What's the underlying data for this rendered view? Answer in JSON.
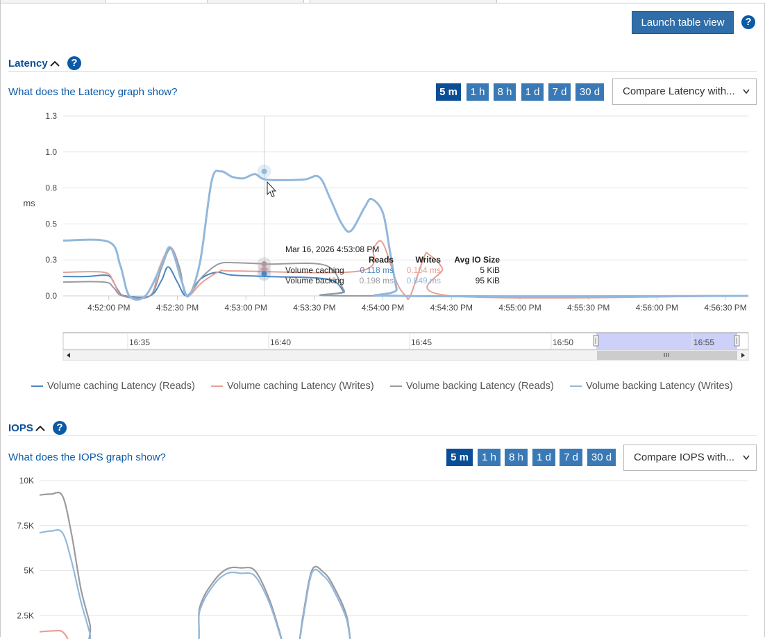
{
  "header": {
    "launch_label": "Launch table view",
    "help_glyph": "?"
  },
  "latency": {
    "title": "Latency",
    "help_glyph": "?",
    "info_link": "What does the Latency graph show?",
    "ranges": [
      "5 m",
      "1 h",
      "8 h",
      "1 d",
      "7 d",
      "30 d"
    ],
    "active_range": "5 m",
    "compare_label": "Compare Latency with...",
    "navigator_ticks": [
      "16:35",
      "16:40",
      "16:45",
      "16:50",
      "16:55"
    ],
    "tooltip": {
      "date": "Mar 16, 2026 4:53:08 PM",
      "headers": [
        "Reads",
        "Writes",
        "Avg IO Size"
      ],
      "rows": [
        {
          "name": "Volume caching",
          "reads": "0.118 ms",
          "writes": "0.154 ms",
          "size": "5 KiB"
        },
        {
          "name": "Volume backing",
          "reads": "0.198 ms",
          "writes": "0.849 ms",
          "size": "95 KiB"
        }
      ]
    },
    "legend": [
      "Volume caching Latency (Reads)",
      "Volume caching Latency (Writes)",
      "Volume backing Latency (Reads)",
      "Volume backing Latency (Writes)"
    ]
  },
  "iops": {
    "title": "IOPS",
    "help_glyph": "?",
    "info_link": "What does the IOPS graph show?",
    "ranges": [
      "5 m",
      "1 h",
      "8 h",
      "1 d",
      "7 d",
      "30 d"
    ],
    "active_range": "5 m",
    "compare_label": "Compare IOPS with..."
  },
  "colors": {
    "caching_reads": "#4a86c0",
    "caching_writes": "#e89e94",
    "backing_reads": "#9a9aa0",
    "backing_writes": "#92b8dc",
    "accent": "#0a4f96"
  },
  "chart_data": [
    {
      "type": "line",
      "ylabel": "ms",
      "ylim": [
        0,
        1.3
      ],
      "y_ticks": [
        "0.0",
        "0.3",
        "0.5",
        "0.8",
        "1.0",
        "1.3"
      ],
      "x_ticks": [
        "4:52:00 PM",
        "4:52:30 PM",
        "4:53:00 PM",
        "4:53:30 PM",
        "4:54:00 PM",
        "4:54:30 PM",
        "4:55:00 PM",
        "4:55:30 PM",
        "4:56:00 PM",
        "4:56:30 PM"
      ],
      "x_unit": "seconds after 4:51:40 PM",
      "series": [
        {
          "name": "Volume caching Latency (Reads)",
          "color": "#4a86c0",
          "points": [
            [
              0,
              0.14
            ],
            [
              10,
              0.14
            ],
            [
              18,
              0.15
            ],
            [
              21,
              0.13
            ],
            [
              24,
              0.04
            ],
            [
              27,
              0
            ],
            [
              38,
              0
            ],
            [
              43,
              0.11
            ],
            [
              46,
              0.21
            ],
            [
              50,
              0.1
            ],
            [
              54,
              0
            ],
            [
              60,
              0.12
            ],
            [
              67,
              0.17
            ],
            [
              74,
              0.15
            ],
            [
              90,
              0.14
            ],
            [
              116,
              0.12
            ],
            [
              123,
              0.03
            ],
            [
              126,
              0
            ],
            [
              300,
              0
            ]
          ]
        },
        {
          "name": "Volume caching Latency (Writes)",
          "color": "#e89e94",
          "points": [
            [
              0,
              0.17
            ],
            [
              18,
              0.17
            ],
            [
              22,
              0.1
            ],
            [
              26,
              0
            ],
            [
              38,
              0
            ],
            [
              42,
              0.2
            ],
            [
              47,
              0.35
            ],
            [
              51,
              0.2
            ],
            [
              54,
              0
            ],
            [
              61,
              0.1
            ],
            [
              69,
              0.18
            ],
            [
              75,
              0.18
            ],
            [
              130,
              0.18
            ],
            [
              136,
              0.35
            ],
            [
              140,
              0.38
            ],
            [
              146,
              0.1
            ],
            [
              150,
              0
            ],
            [
              152,
              0
            ],
            [
              158,
              0.28
            ],
            [
              160,
              0.3
            ],
            [
              166,
              0.2
            ],
            [
              170,
              0
            ],
            [
              300,
              0
            ]
          ]
        },
        {
          "name": "Volume backing Latency (Reads)",
          "color": "#9a9aa0",
          "points": [
            [
              0,
              0.1
            ],
            [
              18,
              0.1
            ],
            [
              22,
              0.06
            ],
            [
              26,
              0
            ],
            [
              38,
              0
            ],
            [
              43,
              0.2
            ],
            [
              47,
              0.34
            ],
            [
              51,
              0.2
            ],
            [
              54,
              0
            ],
            [
              61,
              0.14
            ],
            [
              68,
              0.23
            ],
            [
              75,
              0.24
            ],
            [
              90,
              0.23
            ],
            [
              115,
              0.22
            ],
            [
              123,
              0.04
            ],
            [
              126,
              0
            ],
            [
              300,
              0
            ]
          ]
        },
        {
          "name": "Volume backing Latency (Writes)",
          "color": "#92b8dc",
          "points": [
            [
              0,
              0.4
            ],
            [
              20,
              0.39
            ],
            [
              25,
              0.22
            ],
            [
              29,
              0
            ],
            [
              36,
              0
            ],
            [
              43,
              0.22
            ],
            [
              47,
              0.35
            ],
            [
              52,
              0.1
            ],
            [
              55,
              0
            ],
            [
              60,
              0.25
            ],
            [
              65,
              0.83
            ],
            [
              69,
              0.9
            ],
            [
              74,
              0.86
            ],
            [
              79,
              0.85
            ],
            [
              84,
              0.88
            ],
            [
              89,
              0.84
            ],
            [
              105,
              0.84
            ],
            [
              112,
              0.86
            ],
            [
              117,
              0.7
            ],
            [
              122,
              0.52
            ],
            [
              126,
              0.47
            ],
            [
              132,
              0.64
            ],
            [
              135,
              0.7
            ],
            [
              140,
              0.6
            ],
            [
              143,
              0.33
            ],
            [
              146,
              0.05
            ],
            [
              148,
              0
            ],
            [
              300,
              0
            ]
          ]
        }
      ]
    },
    {
      "type": "line",
      "ylim": [
        0,
        10000
      ],
      "y_ticks": [
        "2.5K",
        "5K",
        "7.5K",
        "10K"
      ],
      "series": [
        {
          "name": "Volume backing Latency (Reads)",
          "color": "#9a9aa0",
          "points": [
            [
              0,
              9200
            ],
            [
              5,
              9250
            ],
            [
              10,
              9150
            ],
            [
              14,
              7000
            ],
            [
              18,
              4000
            ],
            [
              22,
              2000
            ],
            [
              25,
              0
            ],
            [
              65,
              0
            ],
            [
              70,
              3000
            ],
            [
              76,
              4400
            ],
            [
              82,
              5100
            ],
            [
              88,
              5150
            ],
            [
              94,
              5000
            ],
            [
              100,
              3500
            ],
            [
              105,
              1500
            ],
            [
              108,
              0
            ],
            [
              112,
              0
            ],
            [
              115,
              2500
            ],
            [
              119,
              5050
            ],
            [
              124,
              4900
            ],
            [
              128,
              4200
            ],
            [
              134,
              2500
            ],
            [
              138,
              0
            ],
            [
              150,
              0
            ]
          ]
        },
        {
          "name": "Volume backing Latency (Writes)",
          "color": "#92b8dc",
          "points": [
            [
              0,
              7100
            ],
            [
              5,
              7200
            ],
            [
              10,
              7100
            ],
            [
              14,
              5500
            ],
            [
              18,
              3300
            ],
            [
              22,
              1500
            ],
            [
              25,
              0
            ],
            [
              65,
              0
            ],
            [
              70,
              2800
            ],
            [
              76,
              4200
            ],
            [
              82,
              4850
            ],
            [
              88,
              4850
            ],
            [
              94,
              4700
            ],
            [
              100,
              3300
            ],
            [
              105,
              1400
            ],
            [
              108,
              0
            ],
            [
              112,
              0
            ],
            [
              115,
              2300
            ],
            [
              119,
              4900
            ],
            [
              124,
              4700
            ],
            [
              128,
              4000
            ],
            [
              134,
              2300
            ],
            [
              138,
              0
            ],
            [
              150,
              0
            ]
          ]
        },
        {
          "name": "Volume caching Latency (Writes)",
          "color": "#e89e94",
          "points": [
            [
              0,
              1600
            ],
            [
              6,
              1650
            ],
            [
              10,
              1600
            ],
            [
              13,
              1000
            ],
            [
              15,
              0
            ]
          ]
        }
      ]
    }
  ]
}
